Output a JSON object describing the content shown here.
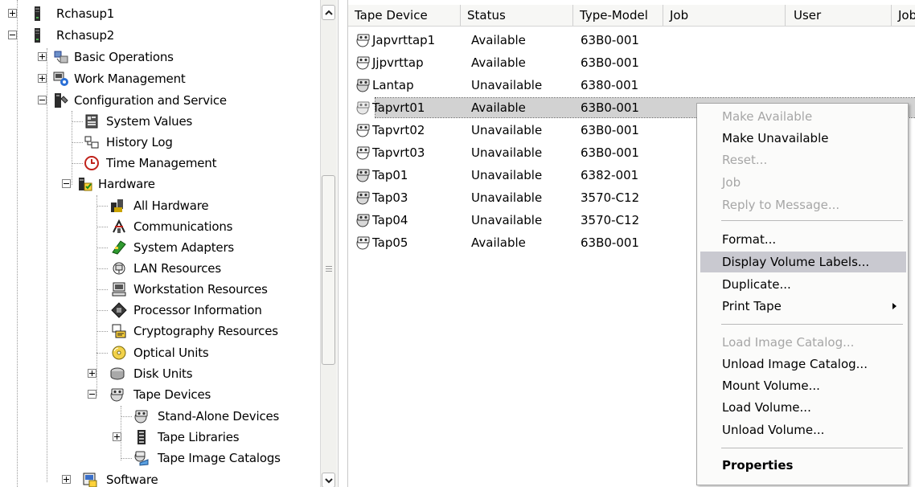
{
  "tree": {
    "nodes": [
      {
        "label": "Rchasup1",
        "icon": "server-icon"
      },
      {
        "label": "Rchasup2",
        "icon": "server-icon"
      },
      {
        "label": "Basic Operations",
        "icon": "basic-operations-icon"
      },
      {
        "label": "Work Management",
        "icon": "work-management-icon"
      },
      {
        "label": "Configuration and Service",
        "icon": "configuration-icon"
      },
      {
        "label": "System Values",
        "icon": "system-values-icon"
      },
      {
        "label": "History Log",
        "icon": "history-log-icon"
      },
      {
        "label": "Time Management",
        "icon": "clock-icon"
      },
      {
        "label": "Hardware",
        "icon": "hardware-icon"
      },
      {
        "label": "All Hardware",
        "icon": "all-hardware-icon"
      },
      {
        "label": "Communications",
        "icon": "communications-icon"
      },
      {
        "label": "System Adapters",
        "icon": "system-adapters-icon"
      },
      {
        "label": "LAN Resources",
        "icon": "lan-resources-icon"
      },
      {
        "label": "Workstation Resources",
        "icon": "workstation-icon"
      },
      {
        "label": "Processor Information",
        "icon": "processor-icon"
      },
      {
        "label": "Cryptography Resources",
        "icon": "cryptography-icon"
      },
      {
        "label": "Optical Units",
        "icon": "optical-disc-icon"
      },
      {
        "label": "Disk Units",
        "icon": "disk-unit-icon"
      },
      {
        "label": "Tape Devices",
        "icon": "tape-device-icon"
      },
      {
        "label": "Stand-Alone Devices",
        "icon": "tape-device-icon"
      },
      {
        "label": "Tape Libraries",
        "icon": "tape-library-icon"
      },
      {
        "label": "Tape Image Catalogs",
        "icon": "tape-catalog-icon"
      },
      {
        "label": "Software",
        "icon": "software-icon"
      }
    ]
  },
  "list": {
    "columns": [
      "Tape Device",
      "Status",
      "Type-Model",
      "Job",
      "User",
      "Job N"
    ],
    "rows": [
      {
        "device": "Japvrttap1",
        "status": "Available",
        "type_model": "63B0-001",
        "icon": "tape-device-icon"
      },
      {
        "device": "Jjpvrttap",
        "status": "Available",
        "type_model": "63B0-001",
        "icon": "tape-device-icon"
      },
      {
        "device": "Lantap",
        "status": "Unavailable",
        "type_model": "6380-001",
        "icon": "tape-device-icon"
      },
      {
        "device": "Tapvrt01",
        "status": "Available",
        "type_model": "63B0-001",
        "icon": "tape-device-icon"
      },
      {
        "device": "Tapvrt02",
        "status": "Unavailable",
        "type_model": "63B0-001",
        "icon": "tape-device-icon"
      },
      {
        "device": "Tapvrt03",
        "status": "Unavailable",
        "type_model": "63B0-001",
        "icon": "tape-device-icon"
      },
      {
        "device": "Tap01",
        "status": "Unavailable",
        "type_model": "6382-001",
        "icon": "tape-device-icon"
      },
      {
        "device": "Tap03",
        "status": "Unavailable",
        "type_model": "3570-C12",
        "icon": "tape-device-icon"
      },
      {
        "device": "Tap04",
        "status": "Unavailable",
        "type_model": "3570-C12",
        "icon": "tape-device-icon"
      },
      {
        "device": "Tap05",
        "status": "Available",
        "type_model": "63B0-001",
        "icon": "tape-device-icon"
      }
    ]
  },
  "context_menu": {
    "items": [
      {
        "label": "Make Available",
        "disabled": true
      },
      {
        "label": "Make Unavailable",
        "disabled": false
      },
      {
        "label": "Reset...",
        "disabled": true
      },
      {
        "label": "Job",
        "disabled": true
      },
      {
        "label": "Reply to Message...",
        "disabled": true
      },
      {
        "label": "Format...",
        "disabled": false
      },
      {
        "label": "Display Volume Labels...",
        "disabled": false,
        "highlighted": true
      },
      {
        "label": "Duplicate...",
        "disabled": false
      },
      {
        "label": "Print Tape",
        "disabled": false,
        "submenu": true
      },
      {
        "label": "Load Image Catalog...",
        "disabled": true
      },
      {
        "label": "Unload Image Catalog...",
        "disabled": false
      },
      {
        "label": "Mount Volume...",
        "disabled": false
      },
      {
        "label": "Load Volume...",
        "disabled": false
      },
      {
        "label": "Unload Volume...",
        "disabled": false
      },
      {
        "label": "Properties",
        "disabled": false,
        "bold": true
      }
    ]
  },
  "colors": {
    "selection": "#d2d2d2",
    "menu_highlight": "#c9c9d0",
    "disabled_text": "#a6a6a6"
  }
}
